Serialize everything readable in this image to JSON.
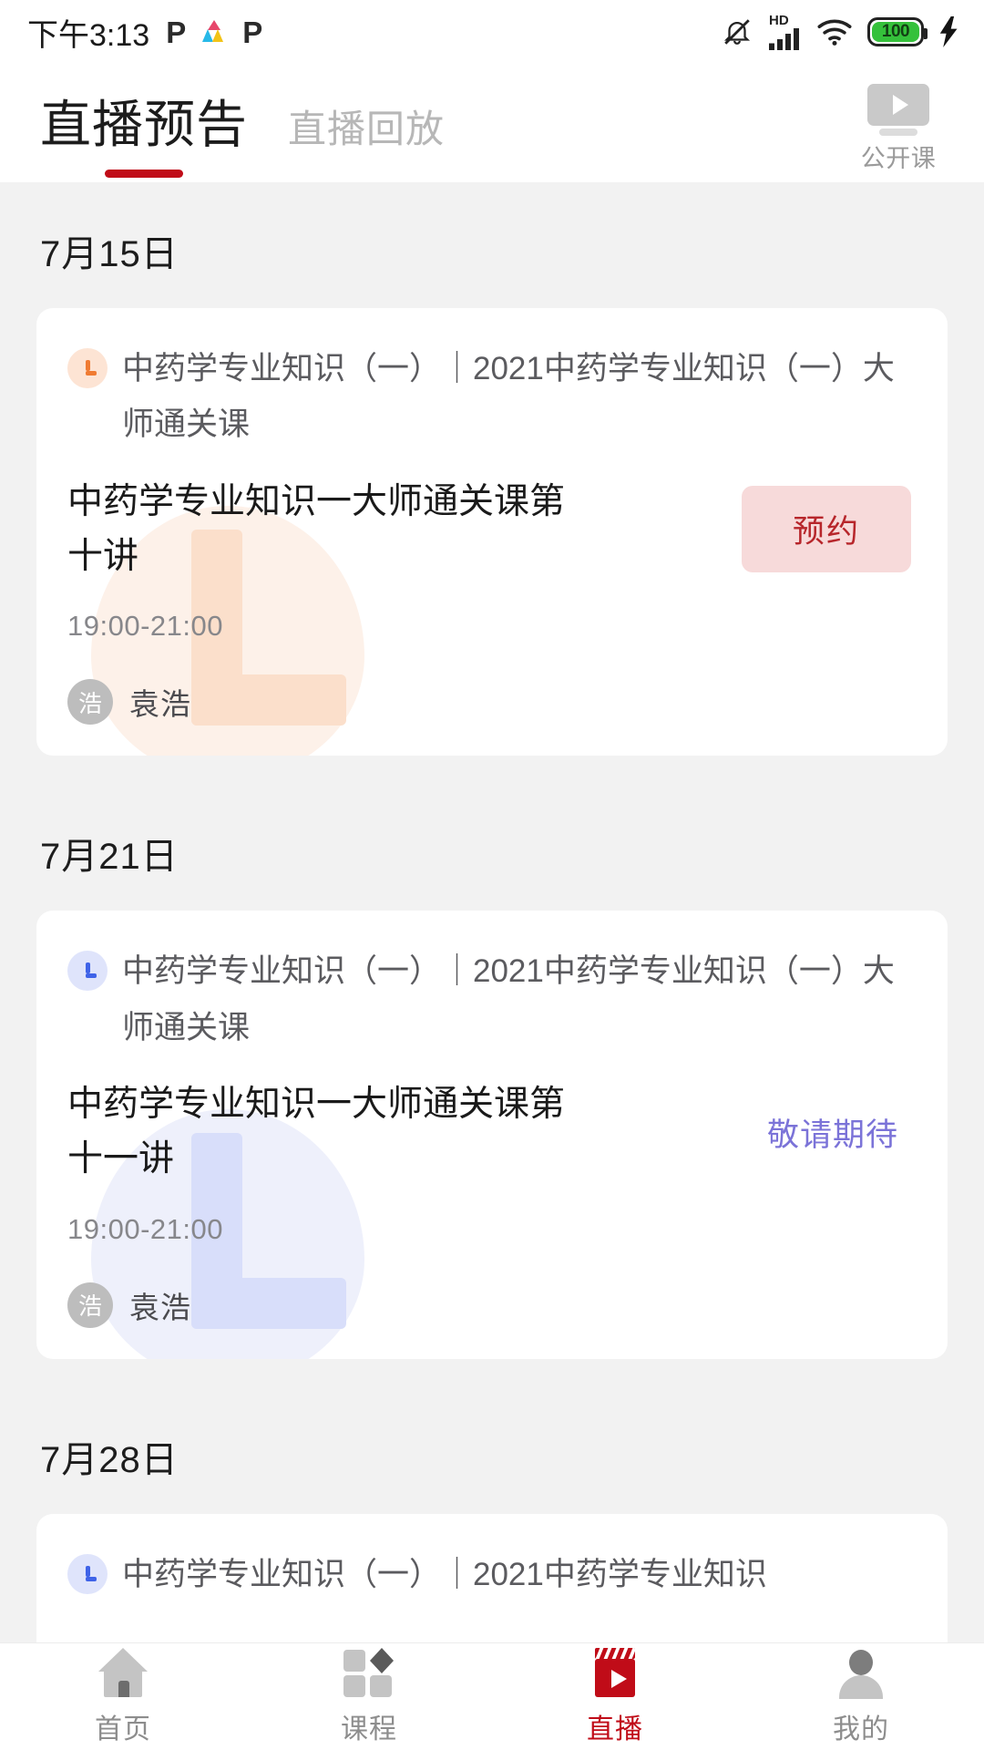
{
  "statusbar": {
    "time": "下午3:13",
    "icons": [
      "p-badge-icon",
      "triangle-logo-icon",
      "p-badge-icon",
      "mute-bell-icon",
      "hd-signal-icon",
      "wifi-icon",
      "battery-icon",
      "charging-bolt-icon"
    ],
    "hd_label": "HD",
    "battery_level": "100"
  },
  "header": {
    "tabs": [
      {
        "label": "直播预告",
        "active": true
      },
      {
        "label": "直播回放",
        "active": false
      }
    ],
    "open_class": {
      "label": "公开课",
      "icon": "video-screen-icon"
    },
    "accent_color": "#c00c18"
  },
  "sections": [
    {
      "date": "7月15日",
      "card": {
        "theme": "peach",
        "clock_icon": "clock-icon",
        "course_name": "中药学专业知识（一）｜2021中药学专业知识（一）大师通关课",
        "lesson_title": "中药学专业知识一大师通关课第十讲",
        "action_kind": "button",
        "action_label": "预约",
        "time": "19:00-21:00",
        "teacher_initial": "浩",
        "teacher_name": "袁浩"
      }
    },
    {
      "date": "7月21日",
      "card": {
        "theme": "lilac",
        "clock_icon": "clock-icon",
        "course_name": "中药学专业知识（一）｜2021中药学专业知识（一）大师通关课",
        "lesson_title": "中药学专业知识一大师通关课第十一讲",
        "action_kind": "text",
        "action_label": "敬请期待",
        "time": "19:00-21:00",
        "teacher_initial": "浩",
        "teacher_name": "袁浩"
      }
    },
    {
      "date": "7月28日",
      "card": {
        "theme": "lilac",
        "clock_icon": "clock-icon",
        "course_name": "中药学专业知识（一）｜2021中药学专业知识"
      }
    }
  ],
  "bottom_nav": [
    {
      "label": "首页",
      "icon": "home-icon",
      "active": false
    },
    {
      "label": "课程",
      "icon": "courses-icon",
      "active": false
    },
    {
      "label": "直播",
      "icon": "live-clapperboard-icon",
      "active": true
    },
    {
      "label": "我的",
      "icon": "profile-icon",
      "active": false
    }
  ]
}
